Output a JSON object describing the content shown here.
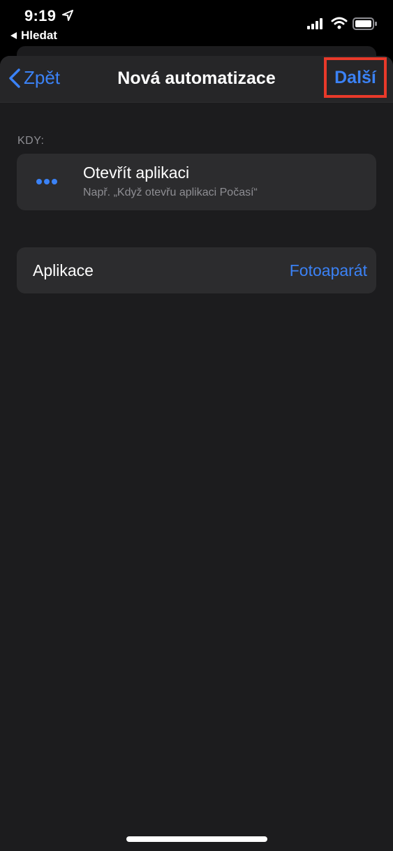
{
  "status_bar": {
    "time": "9:19",
    "back_app_label": "Hledat"
  },
  "nav": {
    "back_label": "Zpět",
    "title": "Nová automatizace",
    "next_label": "Další"
  },
  "section": {
    "label": "KDY:"
  },
  "trigger": {
    "title": "Otevřít aplikaci",
    "subtitle": "Např. „Když otevřu aplikaci Počasí“"
  },
  "app_row": {
    "label": "Aplikace",
    "value": "Fotoaparát"
  },
  "colors": {
    "accent": "#3b82f6",
    "highlight": "#e8392a",
    "background": "#1c1c1e",
    "card": "#2c2c2e"
  }
}
